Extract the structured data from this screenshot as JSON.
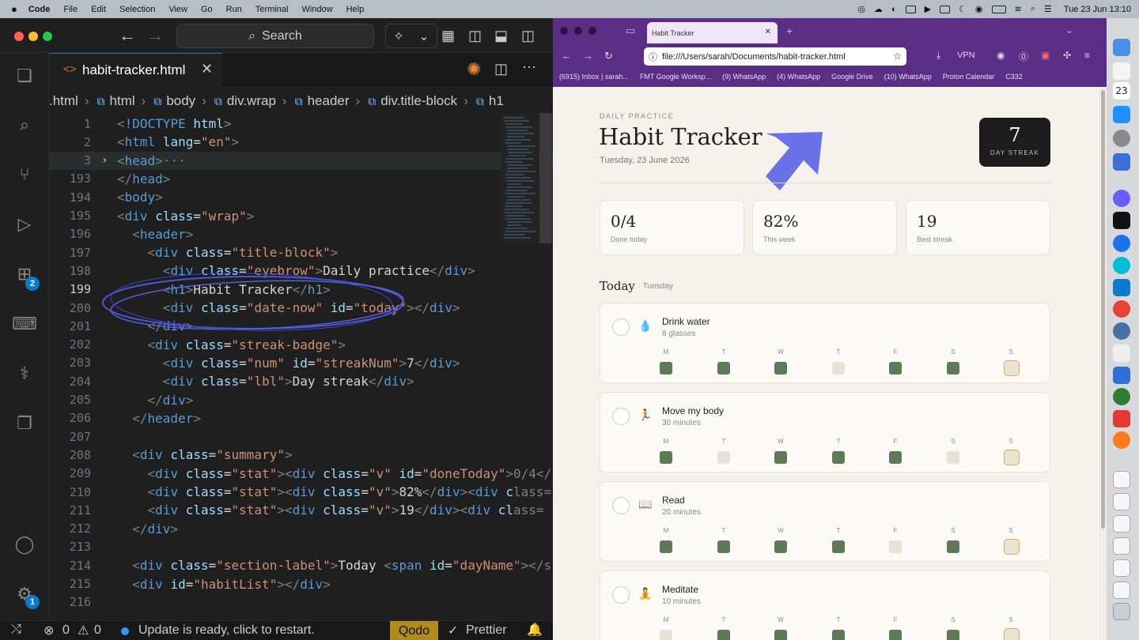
{
  "menubar": {
    "app": "Code",
    "items": [
      "File",
      "Edit",
      "Selection",
      "View",
      "Go",
      "Run",
      "Terminal",
      "Window",
      "Help"
    ],
    "datetime": "Tue 23 Jun  13:10"
  },
  "vscode": {
    "search_label": "Search",
    "tab_label": "habit-tracker.html",
    "breadcrumbs": [
      ".html",
      "html",
      "body",
      "div.wrap",
      "header",
      "div.title-block",
      "h1"
    ],
    "badges": {
      "extensions": "2",
      "settings": "1"
    },
    "code_lines": [
      {
        "n": "1",
        "html": "<span class='p'>&lt;</span><span class='t'>!DOCTYPE</span> <span class='a'>html</span><span class='p'>&gt;</span>"
      },
      {
        "n": "2",
        "html": "<span class='p'>&lt;</span><span class='t'>html</span> <span class='a'>lang</span><span class='x'>=</span><span class='s'>\"en\"</span><span class='p'>&gt;</span>"
      },
      {
        "n": "3",
        "html": "<span class='p'>&lt;</span><span class='t'>head</span><span class='p'>&gt;</span><span class='p'>···</span>"
      },
      {
        "n": "193",
        "html": "<span class='p'>&lt;/</span><span class='t'>head</span><span class='p'>&gt;</span>"
      },
      {
        "n": "194",
        "html": "<span class='p'>&lt;</span><span class='t'>body</span><span class='p'>&gt;</span>"
      },
      {
        "n": "195",
        "html": "<span class='p'>&lt;</span><span class='t'>div</span> <span class='a'>class</span><span class='x'>=</span><span class='s'>\"wrap\"</span><span class='p'>&gt;</span>"
      },
      {
        "n": "196",
        "html": "  <span class='p'>&lt;</span><span class='t'>header</span><span class='p'>&gt;</span>"
      },
      {
        "n": "197",
        "html": "    <span class='p'>&lt;</span><span class='t'>div</span> <span class='a'>class</span><span class='x'>=</span><span class='s'>\"title-block\"</span><span class='p'>&gt;</span>"
      },
      {
        "n": "198",
        "html": "      <span class='p'>&lt;</span><span class='t'>div</span> <span class='a'>class</span><span class='x'>=</span><span class='s'>\"eyebrow\"</span><span class='p'>&gt;</span><span class='x'>Daily practice</span><span class='p'>&lt;/</span><span class='t'>div</span><span class='p'>&gt;</span>"
      },
      {
        "n": "199",
        "html": "      <span class='p'>&lt;</span><span class='t'>h1</span><span class='p'>&gt;</span><span class='x'>Habit Tracker</span><span class='p'>&lt;/</span><span class='t'>h1</span><span class='p'>&gt;</span>"
      },
      {
        "n": "200",
        "html": "      <span class='p'>&lt;</span><span class='t'>div</span> <span class='a'>class</span><span class='x'>=</span><span class='s'>\"date-now\"</span> <span class='a'>id</span><span class='x'>=</span><span class='s'>\"today\"</span><span class='p'>&gt;&lt;/</span><span class='t'>div</span><span class='p'>&gt;</span>"
      },
      {
        "n": "201",
        "html": "    <span class='p'>&lt;/</span><span class='t'>div</span><span class='p'>&gt;</span>"
      },
      {
        "n": "202",
        "html": "    <span class='p'>&lt;</span><span class='t'>div</span> <span class='a'>class</span><span class='x'>=</span><span class='s'>\"streak-badge\"</span><span class='p'>&gt;</span>"
      },
      {
        "n": "203",
        "html": "      <span class='p'>&lt;</span><span class='t'>div</span> <span class='a'>class</span><span class='x'>=</span><span class='s'>\"num\"</span> <span class='a'>id</span><span class='x'>=</span><span class='s'>\"streakNum\"</span><span class='p'>&gt;</span><span class='x'>7</span><span class='p'>&lt;/</span><span class='t'>div</span><span class='p'>&gt;</span>"
      },
      {
        "n": "204",
        "html": "      <span class='p'>&lt;</span><span class='t'>div</span> <span class='a'>class</span><span class='x'>=</span><span class='s'>\"lbl\"</span><span class='p'>&gt;</span><span class='x'>Day streak</span><span class='p'>&lt;/</span><span class='t'>div</span><span class='p'>&gt;</span>"
      },
      {
        "n": "205",
        "html": "    <span class='p'>&lt;/</span><span class='t'>div</span><span class='p'>&gt;</span>"
      },
      {
        "n": "206",
        "html": "  <span class='p'>&lt;/</span><span class='t'>header</span><span class='p'>&gt;</span>"
      },
      {
        "n": "207",
        "html": ""
      },
      {
        "n": "208",
        "html": "  <span class='p'>&lt;</span><span class='t'>div</span> <span class='a'>class</span><span class='x'>=</span><span class='s'>\"summary\"</span><span class='p'>&gt;</span>"
      },
      {
        "n": "209",
        "html": "    <span class='p'>&lt;</span><span class='t'>div</span> <span class='a'>class</span><span class='x'>=</span><span class='s'>\"stat\"</span><span class='p'>&gt;&lt;</span><span class='t'>div</span> <span class='a'>class</span><span class='x'>=</span><span class='s'>\"v\"</span> <span class='a'>id</span><span class='x'>=</span><span class='s'>\"doneToday\"</span><span class='p'>&gt;0/4&lt;/</span>"
      },
      {
        "n": "210",
        "html": "    <span class='p'>&lt;</span><span class='t'>div</span> <span class='a'>class</span><span class='x'>=</span><span class='s'>\"stat\"</span><span class='p'>&gt;&lt;</span><span class='t'>div</span> <span class='a'>class</span><span class='x'>=</span><span class='s'>\"v\"</span><span class='p'>&gt;</span><span class='x'>82%</span><span class='p'>&lt;/</span><span class='t'>div</span><span class='p'>&gt;&lt;</span><span class='t'>div</span> <span class='a'>c</span><span class='p'>lass=</span>"
      },
      {
        "n": "211",
        "html": "    <span class='p'>&lt;</span><span class='t'>div</span> <span class='a'>class</span><span class='x'>=</span><span class='s'>\"stat\"</span><span class='p'>&gt;&lt;</span><span class='t'>div</span> <span class='a'>class</span><span class='x'>=</span><span class='s'>\"v\"</span><span class='p'>&gt;</span><span class='x'>19</span><span class='p'>&lt;/</span><span class='t'>div</span><span class='p'>&gt;&lt;</span><span class='t'>div</span> <span class='a'>cl</span><span class='p'>ass=</span>"
      },
      {
        "n": "212",
        "html": "  <span class='p'>&lt;/</span><span class='t'>div</span><span class='p'>&gt;</span>"
      },
      {
        "n": "213",
        "html": ""
      },
      {
        "n": "214",
        "html": "  <span class='p'>&lt;</span><span class='t'>div</span> <span class='a'>class</span><span class='x'>=</span><span class='s'>\"section-label\"</span><span class='p'>&gt;</span><span class='x'>Today </span><span class='p'>&lt;</span><span class='t'>span</span> <span class='a'>id</span><span class='x'>=</span><span class='s'>\"dayName</span><span class='p'>\"&gt;&lt;/s</span>"
      },
      {
        "n": "215",
        "html": "  <span class='p'>&lt;</span><span class='t'>div</span> <span class='a'>id</span><span class='x'>=</span><span class='s'>\"habitList\"</span><span class='p'>&gt;&lt;/</span><span class='t'>div</span><span class='p'>&gt;</span>"
      },
      {
        "n": "216",
        "html": ""
      }
    ],
    "status": {
      "errors": "0",
      "warnings": "0",
      "message": "Update is ready, click to restart.",
      "qodo": "Qodo",
      "prettier": "Prettier"
    }
  },
  "browser": {
    "tab_title": "Habit Tracker",
    "url": "file:///Users/sarah/Documents/habit-tracker.html",
    "vpn": "VPN",
    "bookmarks": [
      "(6915) Inbox | sarah...",
      "FMT Google Worksp...",
      "(9) WhatsApp",
      "(4) WhatsApp",
      "Google Drive",
      "(10) WhatsApp",
      "Proton Calendar",
      "C332"
    ]
  },
  "app": {
    "eyebrow": "DAILY PRACTICE",
    "title": "Habit Tracker",
    "date": "Tuesday, 23 June 2026",
    "streak_num": "7",
    "streak_label": "DAY STREAK",
    "stats": [
      {
        "value": "0/4",
        "label": "Done today"
      },
      {
        "value": "82%",
        "label": "This week"
      },
      {
        "value": "19",
        "label": "Best streak"
      }
    ],
    "section_label": "Today",
    "day_name": "· Tuesday",
    "days": [
      "M",
      "T",
      "W",
      "T",
      "F",
      "S",
      "S"
    ],
    "habits": [
      {
        "name": "Drink water",
        "detail": "8 glasses",
        "emoji": "💧",
        "week": [
          1,
          1,
          1,
          0,
          1,
          1,
          2
        ]
      },
      {
        "name": "Move my body",
        "detail": "30 minutes",
        "emoji": "🏃",
        "week": [
          1,
          0,
          1,
          1,
          1,
          0,
          2
        ]
      },
      {
        "name": "Read",
        "detail": "20 minutes",
        "emoji": "📖",
        "week": [
          1,
          1,
          1,
          1,
          0,
          1,
          2
        ]
      },
      {
        "name": "Meditate",
        "detail": "10 minutes",
        "emoji": "🧘",
        "week": [
          0,
          1,
          1,
          1,
          1,
          1,
          2
        ]
      }
    ]
  },
  "colors": {
    "done": "#5e7a57",
    "missed": "#e7e2d6",
    "today_border": "#d8a95a",
    "annotation_arrow": "#6b72e8",
    "browser_chrome": "#5b2e86"
  }
}
